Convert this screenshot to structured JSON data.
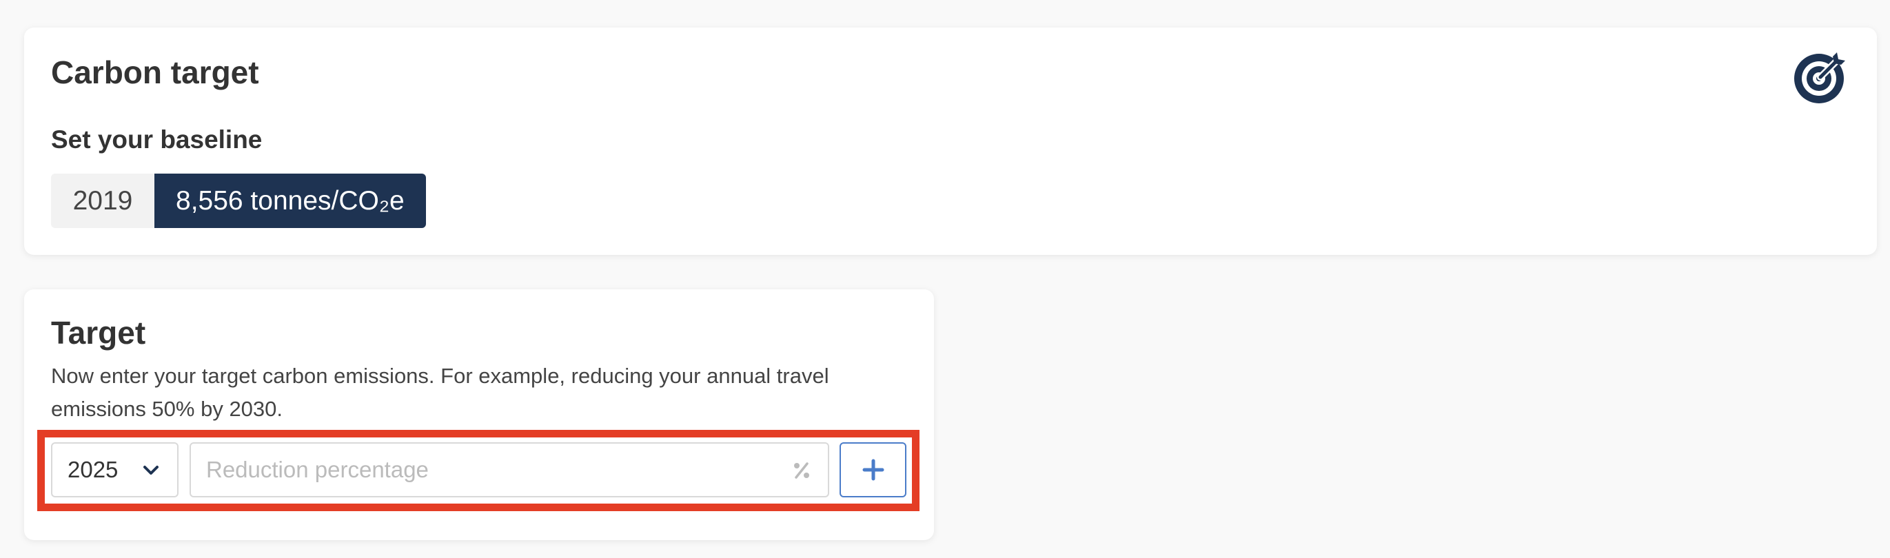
{
  "baseline_card": {
    "title": "Carbon target",
    "icon": "target-icon",
    "subheading": "Set your baseline",
    "baseline_year": "2019",
    "baseline_value": "8,556 tonnes/CO₂e"
  },
  "target_card": {
    "title": "Target",
    "description": "Now enter your target carbon emissions. For example, reducing your annual travel emissions 50% by 2030.",
    "year_select": {
      "selected": "2025",
      "icon": "chevron-down-icon"
    },
    "reduction_input": {
      "value": "",
      "placeholder": "Reduction percentage",
      "icon": "percent-icon"
    },
    "add_button": {
      "icon": "plus-icon"
    }
  },
  "colors": {
    "navy": "#1e3352",
    "highlight_red": "#e43d25",
    "button_blue": "#4a7cc9"
  }
}
